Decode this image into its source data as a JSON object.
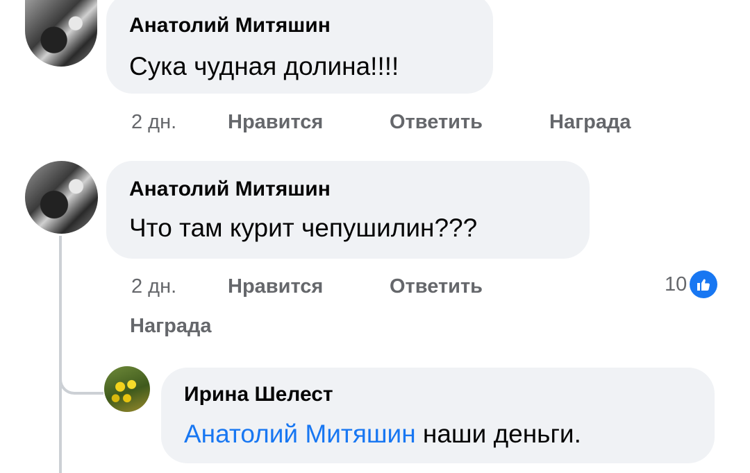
{
  "comments": [
    {
      "author": "Анатолий Митяшин",
      "text": "Сука чудная долина!!!!",
      "time": "2 дн.",
      "like_label": "Нравится",
      "reply_label": "Ответить",
      "award_label": "Награда"
    },
    {
      "author": "Анатолий Митяшин",
      "text": "Что там курит чепушилин???",
      "time": "2 дн.",
      "like_label": "Нравится",
      "reply_label": "Ответить",
      "award_label": "Награда",
      "reaction_count": "10",
      "reaction_icon": "like-icon"
    }
  ],
  "reply": {
    "author": "Ирина Шелест",
    "mention": "Анатолий Митяшин",
    "text": "наши деньги."
  },
  "colors": {
    "bubble": "#f0f2f5",
    "mention": "#1877f2",
    "meta": "#65676b",
    "like": "#1877f2"
  }
}
